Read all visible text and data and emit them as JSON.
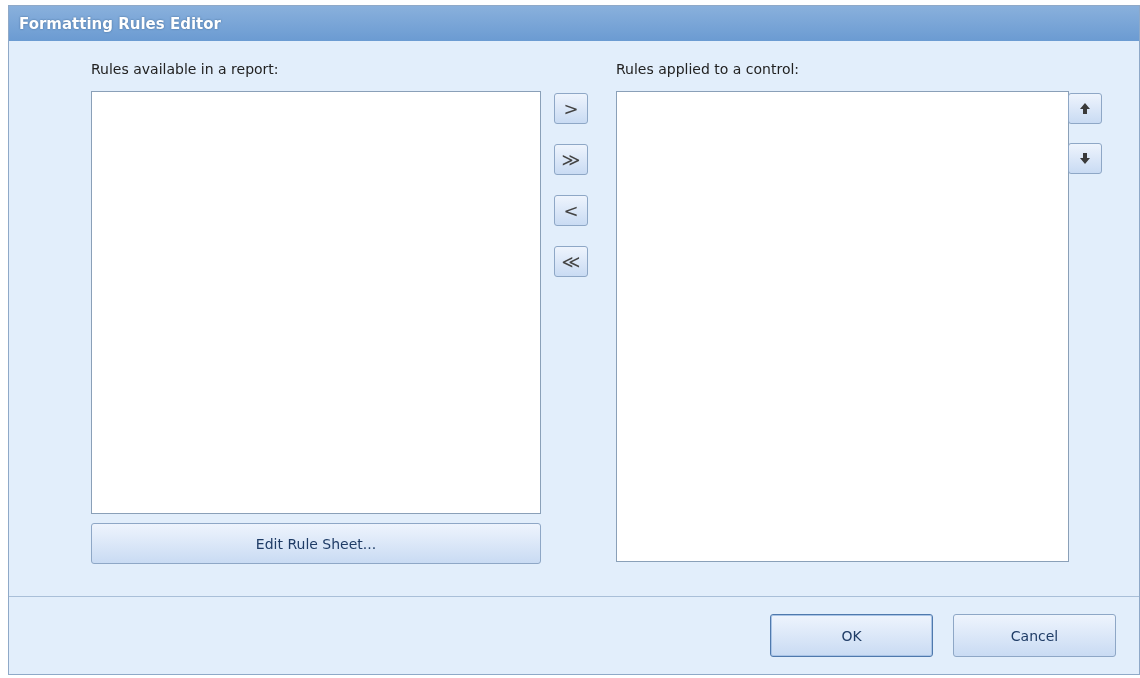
{
  "window": {
    "title": "Formatting Rules Editor"
  },
  "available_rules": {
    "label": "Rules available in a report:",
    "button": "Edit Rule Sheet..."
  },
  "transfer_buttons": [
    ">",
    "≫",
    "<",
    "≪"
  ],
  "applied_rules": {
    "label": "Rules applied to a control:"
  },
  "order_buttons": [
    {
      "kind": "up"
    },
    {
      "kind": "down"
    }
  ],
  "footer_buttons": [
    "OK",
    "Cancel"
  ]
}
